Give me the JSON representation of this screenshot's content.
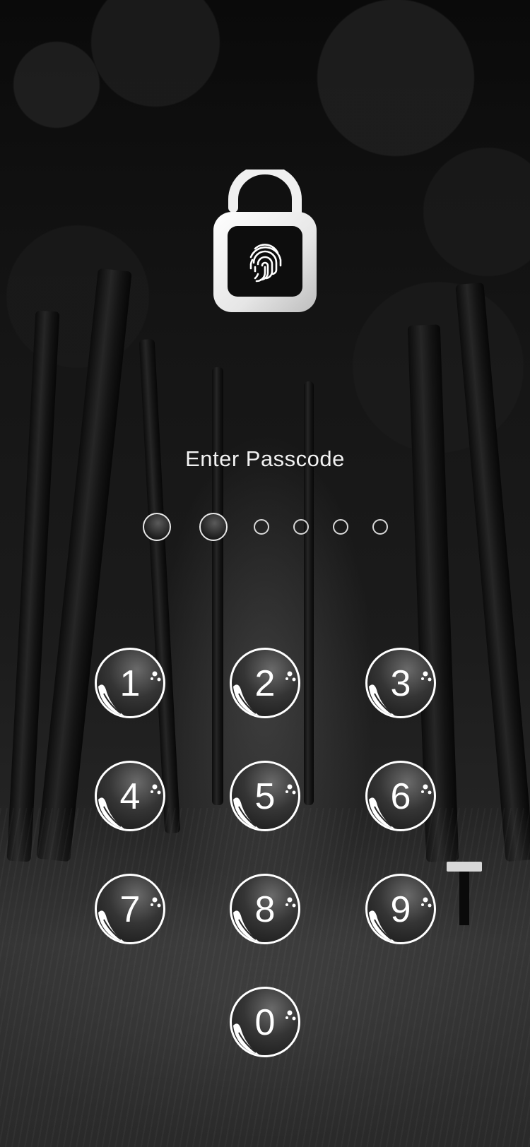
{
  "screen": {
    "title": "Enter Passcode",
    "lock_icon": "padlock-fingerprint-icon"
  },
  "passcode": {
    "length": 6,
    "entered_count": 2
  },
  "keypad": {
    "keys": [
      "1",
      "2",
      "3",
      "4",
      "5",
      "6",
      "7",
      "8",
      "9",
      "0"
    ]
  },
  "colors": {
    "text": "#f2f2f2",
    "key_border": "#ffffff",
    "lock": "#ececec"
  }
}
